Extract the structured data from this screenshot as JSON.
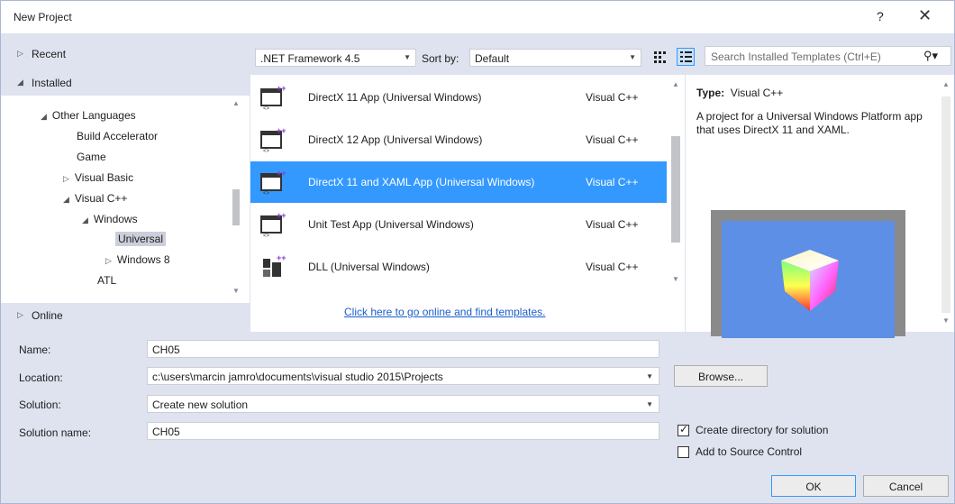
{
  "window": {
    "title": "New Project",
    "help": "?",
    "close": "✕"
  },
  "left": {
    "recent": "Recent",
    "installed": "Installed",
    "online": "Online",
    "tree": [
      {
        "label": "Other Languages",
        "expander": "◢"
      },
      {
        "label": "Build Accelerator",
        "expander": ""
      },
      {
        "label": "Game",
        "expander": ""
      },
      {
        "label": "Visual Basic",
        "expander": "▷"
      },
      {
        "label": "Visual C++",
        "expander": "◢"
      },
      {
        "label": "Windows",
        "expander": "◢"
      },
      {
        "label": "Universal",
        "expander": "",
        "selected": true
      },
      {
        "label": "Windows 8",
        "expander": "▷"
      },
      {
        "label": "ATL",
        "expander": ""
      }
    ]
  },
  "toolbar": {
    "framework": ".NET Framework 4.5",
    "sort_label": "Sort by:",
    "sort_value": "Default",
    "search_placeholder": "Search Installed Templates (Ctrl+E)"
  },
  "templates": [
    {
      "name": "DirectX 11 App (Universal Windows)",
      "lang": "Visual C++",
      "icon": "directx-app-icon",
      "selected": false
    },
    {
      "name": "DirectX 12 App (Universal Windows)",
      "lang": "Visual C++",
      "icon": "directx-app-icon",
      "selected": false
    },
    {
      "name": "DirectX 11 and XAML App (Universal Windows)",
      "lang": "Visual C++",
      "icon": "directx-xaml-app-icon",
      "selected": true
    },
    {
      "name": "Unit Test App (Universal Windows)",
      "lang": "Visual C++",
      "icon": "unit-test-app-icon",
      "selected": false
    },
    {
      "name": "DLL (Universal Windows)",
      "lang": "Visual C++",
      "icon": "dll-icon",
      "selected": false
    }
  ],
  "online_link": "Click here to go online and find templates.",
  "details": {
    "type_label": "Type:",
    "type_value": "Visual C++",
    "description": "A project for a Universal Windows Platform app that uses DirectX 11 and XAML."
  },
  "form": {
    "name_label": "Name:",
    "name_value": "CH05",
    "location_label": "Location:",
    "location_value": "c:\\users\\marcin jamro\\documents\\visual studio 2015\\Projects",
    "solution_label": "Solution:",
    "solution_value": "Create new solution",
    "solution_name_label": "Solution name:",
    "solution_name_value": "CH05",
    "browse": "Browse...",
    "create_dir_label": "Create directory for solution",
    "create_dir_checked": true,
    "source_control_label": "Add to Source Control",
    "source_control_checked": false,
    "ok": "OK",
    "cancel": "Cancel"
  },
  "colors": {
    "accent": "#3399ff",
    "dialog_bg": "#dfe3ef",
    "link": "#1a5fcc"
  }
}
